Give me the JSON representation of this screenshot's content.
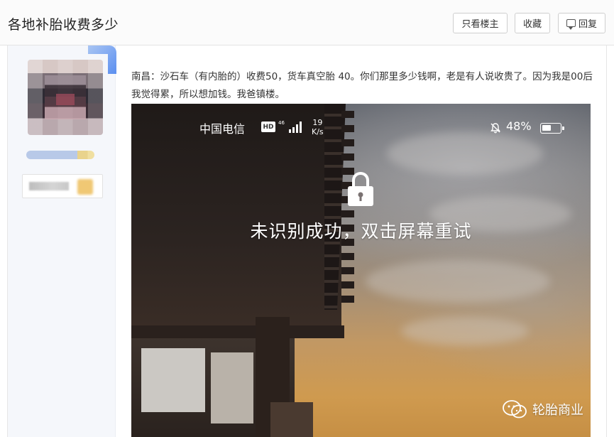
{
  "header": {
    "title": "各地补胎收费多少",
    "btn_only_op": "只看楼主",
    "btn_favorite": "收藏",
    "btn_reply": "回复"
  },
  "post": {
    "text": "南昌：沙石车（有内胎的）收费50，货车真空胎 40。你们那里多少钱啊，老是有人说收贵了。因为我是00后我觉得累，所以想加钱。我爸镇楼。"
  },
  "phone": {
    "carrier": "中国电信",
    "hd": "HD",
    "net_type": "46",
    "speed_value": "19",
    "speed_unit": "K/s",
    "battery": "48%",
    "lock_message": "未识别成功，双击屏幕重试"
  },
  "watermark": {
    "text": "轮胎商业"
  },
  "colors": {
    "accent_blue": "#5b8ff0",
    "sidebar_bg": "#f5f7fb"
  }
}
